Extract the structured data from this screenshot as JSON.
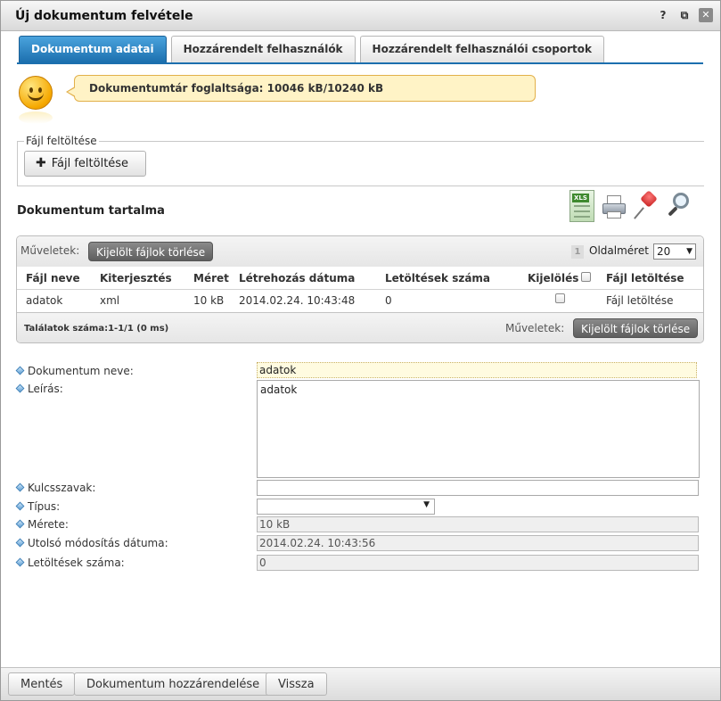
{
  "window": {
    "title": "Új dokumentum felvétele"
  },
  "titlebar_icons": [
    "help-icon",
    "popout-icon",
    "close-icon"
  ],
  "tabs": [
    {
      "label": "Dokumentum adatai",
      "active": true
    },
    {
      "label": "Hozzárendelt felhasználók",
      "active": false
    },
    {
      "label": "Hozzárendelt felhasználói csoportok",
      "active": false
    }
  ],
  "quota": {
    "text": "Dokumentumtár foglaltsága: 10046 kB/10240 kB"
  },
  "upload": {
    "legend": "Fájl feltöltése",
    "button_label": "Fájl feltöltése"
  },
  "content": {
    "title": "Dokumentum tartalma"
  },
  "tools": [
    "excel-export-icon",
    "print-icon",
    "pin-icon",
    "search-zoom-icon"
  ],
  "grid": {
    "ops_label": "Műveletek:",
    "delete_selected_label": "Kijelölt fájlok törlése",
    "page": "1",
    "page_size_label": "Oldalméret",
    "page_size": "20",
    "columns": [
      "Fájl neve",
      "Kiterjesztés",
      "Méret",
      "Létrehozás dátuma",
      "Letöltések száma",
      "Kijelölés",
      "Fájl letöltése"
    ],
    "rows": [
      {
        "name": "adatok",
        "ext": "xml",
        "size": "10 kB",
        "created": "2014.02.24. 10:43:48",
        "downloads": "0",
        "download_link": "Fájl letöltése"
      }
    ],
    "result_count": "Találatok száma:1-1/1 (0 ms)"
  },
  "form": {
    "doc_name_label": "Dokumentum neve:",
    "doc_name_value": "adatok",
    "desc_label": "Leírás:",
    "desc_value": "adatok",
    "keywords_label": "Kulcsszavak:",
    "keywords_value": "",
    "type_label": "Típus:",
    "type_value": "",
    "size_label": "Mérete:",
    "size_value": "10 kB",
    "modified_label": "Utolsó módosítás dátuma:",
    "modified_value": "2014.02.24. 10:43:56",
    "downloads_label": "Letöltések száma:",
    "downloads_value": "0"
  },
  "footer": {
    "save": "Mentés",
    "assign": "Dokumentum hozzárendelése",
    "back": "Vissza"
  }
}
